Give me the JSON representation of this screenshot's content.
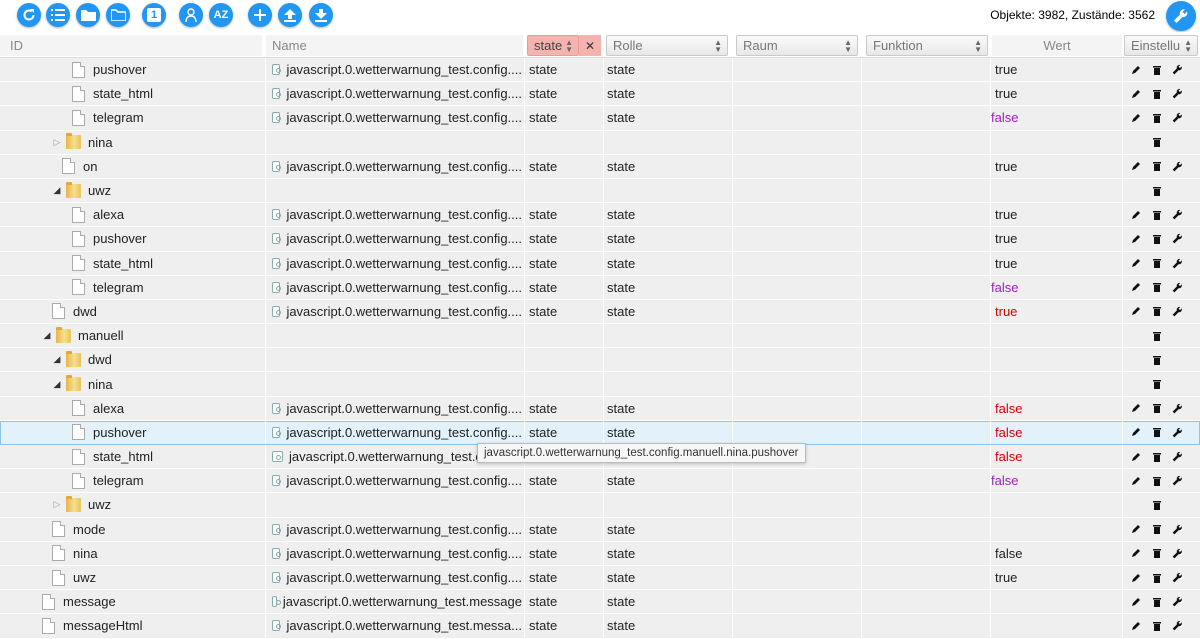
{
  "toolbar": {
    "buttons": [
      "refresh-icon",
      "list-icon",
      "folder-icon",
      "folder-open-icon",
      "single-icon",
      "expert-icon",
      "sort-az-icon",
      "add-icon",
      "upload-icon",
      "download-icon"
    ],
    "sort_label": "AZ",
    "single_label": "1",
    "stats": "Objekte: 3982, Zustände: 3562"
  },
  "header": {
    "id": "ID",
    "name": "Name",
    "type": "state",
    "role": "Rolle",
    "room": "Raum",
    "function": "Funktion",
    "value": "Wert",
    "settings": "Einstellu",
    "clear": "✕"
  },
  "tooltip": "javascript.0.wetterwarnung_test.config.manuell.nina.pushover",
  "colors": {
    "accent": "#2196f3",
    "value_false_red": "#dd0000",
    "value_false_purple": "#a020c0",
    "state_header": "#f5b3b0"
  },
  "rows": [
    {
      "id": "pushover",
      "kind": "doc",
      "level": 3,
      "name": "javascript.0.wetterwarnung_test.config....",
      "type": "state",
      "role": "state",
      "value": "true",
      "vstyle": "t",
      "actions": true
    },
    {
      "id": "state_html",
      "kind": "doc",
      "level": 3,
      "name": "javascript.0.wetterwarnung_test.config....",
      "type": "state",
      "role": "state",
      "value": "true",
      "vstyle": "t",
      "actions": true
    },
    {
      "id": "telegram",
      "kind": "doc",
      "level": 3,
      "name": "javascript.0.wetterwarnung_test.config....",
      "type": "state",
      "role": "state",
      "value": "false",
      "vstyle": "fp",
      "actions": true
    },
    {
      "id": "nina",
      "kind": "folder",
      "toggle": "▷",
      "level": 2,
      "name": "",
      "type": "",
      "role": "",
      "value": "",
      "vstyle": "",
      "actions": false
    },
    {
      "id": "on",
      "kind": "doc",
      "level": 2,
      "name": "javascript.0.wetterwarnung_test.config....",
      "type": "state",
      "role": "state",
      "value": "true",
      "vstyle": "t",
      "actions": true
    },
    {
      "id": "uwz",
      "kind": "folder",
      "toggle": "◢",
      "level": 2,
      "name": "",
      "type": "",
      "role": "",
      "value": "",
      "vstyle": "",
      "actions": false
    },
    {
      "id": "alexa",
      "kind": "doc",
      "level": 3,
      "name": "javascript.0.wetterwarnung_test.config....",
      "type": "state",
      "role": "state",
      "value": "true",
      "vstyle": "t",
      "actions": true
    },
    {
      "id": "pushover",
      "kind": "doc",
      "level": 3,
      "name": "javascript.0.wetterwarnung_test.config....",
      "type": "state",
      "role": "state",
      "value": "true",
      "vstyle": "t",
      "actions": true
    },
    {
      "id": "state_html",
      "kind": "doc",
      "level": 3,
      "name": "javascript.0.wetterwarnung_test.config....",
      "type": "state",
      "role": "state",
      "value": "true",
      "vstyle": "t",
      "actions": true
    },
    {
      "id": "telegram",
      "kind": "doc",
      "level": 3,
      "name": "javascript.0.wetterwarnung_test.config....",
      "type": "state",
      "role": "state",
      "value": "false",
      "vstyle": "fp",
      "actions": true
    },
    {
      "id": "dwd",
      "kind": "doc",
      "level": 1,
      "name": "javascript.0.wetterwarnung_test.config....",
      "type": "state",
      "role": "state",
      "value": "true",
      "vstyle": "fr",
      "actions": true
    },
    {
      "id": "manuell",
      "kind": "folder",
      "toggle": "◢",
      "level": 1,
      "name": "",
      "type": "",
      "role": "",
      "value": "",
      "vstyle": "",
      "actions": false
    },
    {
      "id": "dwd",
      "kind": "folder",
      "toggle": "◢",
      "level": 2,
      "name": "",
      "type": "",
      "role": "",
      "value": "",
      "vstyle": "",
      "actions": false
    },
    {
      "id": "nina",
      "kind": "folder",
      "toggle": "◢",
      "level": 2,
      "name": "",
      "type": "",
      "role": "",
      "value": "",
      "vstyle": "",
      "actions": false
    },
    {
      "id": "alexa",
      "kind": "doc",
      "level": 3,
      "name": "javascript.0.wetterwarnung_test.config....",
      "type": "state",
      "role": "state",
      "value": "false",
      "vstyle": "fr",
      "actions": true
    },
    {
      "id": "pushover",
      "kind": "doc",
      "level": 3,
      "name": "javascript.0.wetterwarnung_test.config....",
      "type": "state",
      "role": "state",
      "value": "false",
      "vstyle": "fr",
      "actions": true,
      "highlight": true
    },
    {
      "id": "state_html",
      "kind": "doc",
      "level": 3,
      "name": "javascript.0.wetterwarnung_test.c",
      "type": "",
      "role": "",
      "value": "false",
      "vstyle": "fr",
      "actions": true
    },
    {
      "id": "telegram",
      "kind": "doc",
      "level": 3,
      "name": "javascript.0.wetterwarnung_test.config....",
      "type": "state",
      "role": "state",
      "value": "false",
      "vstyle": "fp",
      "actions": true
    },
    {
      "id": "uwz",
      "kind": "folder",
      "toggle": "▷",
      "level": 2,
      "name": "",
      "type": "",
      "role": "",
      "value": "",
      "vstyle": "",
      "actions": false
    },
    {
      "id": "mode",
      "kind": "doc",
      "level": 1,
      "name": "javascript.0.wetterwarnung_test.config....",
      "type": "state",
      "role": "state",
      "value": "",
      "vstyle": "t",
      "actions": true
    },
    {
      "id": "nina",
      "kind": "doc",
      "level": 1,
      "name": "javascript.0.wetterwarnung_test.config....",
      "type": "state",
      "role": "state",
      "value": "false",
      "vstyle": "t",
      "actions": true
    },
    {
      "id": "uwz",
      "kind": "doc",
      "level": 1,
      "name": "javascript.0.wetterwarnung_test.config....",
      "type": "state",
      "role": "state",
      "value": "true",
      "vstyle": "t",
      "actions": true
    },
    {
      "id": "message",
      "kind": "doc",
      "level": 0,
      "name": "javascript.0.wetterwarnung_test.message",
      "type": "state",
      "role": "state",
      "value": "",
      "vstyle": "t",
      "actions": true
    },
    {
      "id": "messageHtml",
      "kind": "doc",
      "level": 0,
      "name": "javascript.0.wetterwarnung_test.messa...",
      "type": "state",
      "role": "state",
      "value": "",
      "vstyle": "t",
      "actions": true
    }
  ]
}
